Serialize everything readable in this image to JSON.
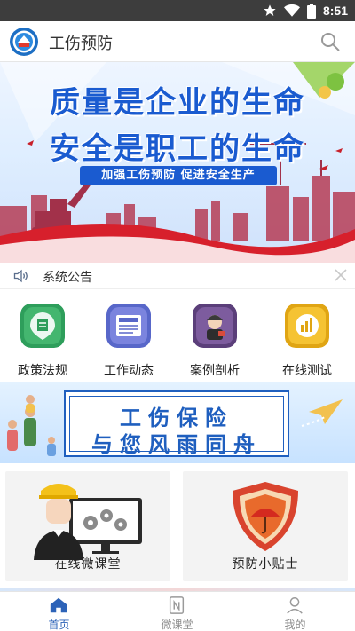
{
  "status_bar": {
    "time": "8:51"
  },
  "app_bar": {
    "title": "工伤预防"
  },
  "hero": {
    "line1": "质量是企业的生命",
    "line2": "安全是职工的生命",
    "slogan": "加强工伤预防  促进安全生产"
  },
  "notice": {
    "label": "系统公告"
  },
  "categories": [
    {
      "label": "政策法规",
      "icon": "policy-icon"
    },
    {
      "label": "工作动态",
      "icon": "news-icon"
    },
    {
      "label": "案例剖析",
      "icon": "case-icon"
    },
    {
      "label": "在线测试",
      "icon": "test-icon"
    }
  ],
  "insurance_banner": {
    "line1": "工伤保险",
    "line2": "与您风雨同舟"
  },
  "cards": [
    {
      "label": "在线微课堂",
      "icon": "worker-computer-illustration"
    },
    {
      "label": "预防小贴士",
      "icon": "umbrella-shield-illustration"
    }
  ],
  "tabs": [
    {
      "label": "首页",
      "icon": "home-icon",
      "active": true
    },
    {
      "label": "微课堂",
      "icon": "course-icon",
      "active": false
    },
    {
      "label": "我的",
      "icon": "profile-icon",
      "active": false
    }
  ],
  "colors": {
    "primary": "#2d63b8",
    "status_bar": "#3d3d3d",
    "hero_text": "#1a5bd0"
  }
}
